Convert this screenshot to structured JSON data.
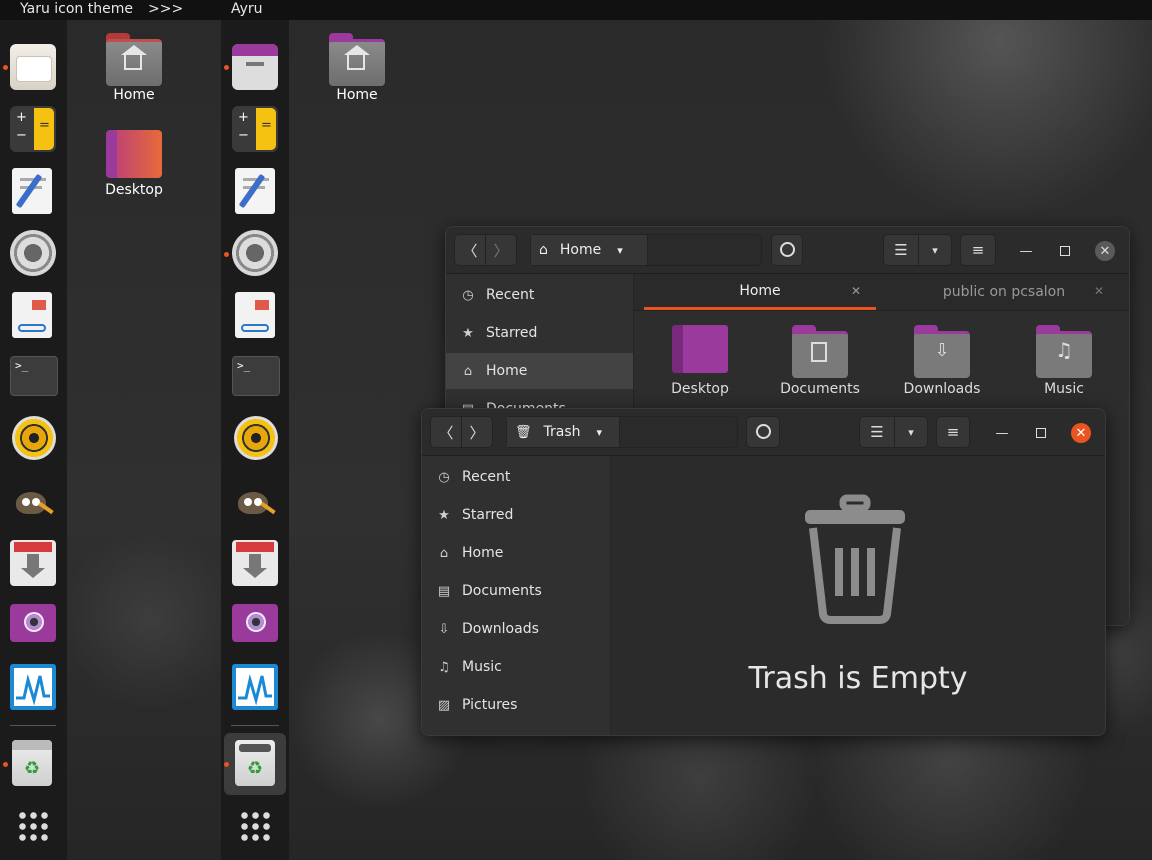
{
  "topbar": {
    "left_label": "Yaru icon theme",
    "arrows": ">>>",
    "right_label": "Ayru"
  },
  "desktop_icons": {
    "left_home": "Home",
    "left_desktop": "Desktop",
    "right_home": "Home"
  },
  "back_window": {
    "location": "Home",
    "sidebar": [
      "Recent",
      "Starred",
      "Home",
      "Documents"
    ],
    "tabs": [
      {
        "label": "Home",
        "active": true
      },
      {
        "label": "public on pcsalon",
        "active": false
      }
    ],
    "folders": [
      "Desktop",
      "Documents",
      "Downloads",
      "Music"
    ]
  },
  "trash_window": {
    "location": "Trash",
    "sidebar": [
      "Recent",
      "Starred",
      "Home",
      "Documents",
      "Downloads",
      "Music",
      "Pictures"
    ],
    "empty_message": "Trash is Empty"
  },
  "colors": {
    "accent_orange": "#e95420",
    "folder_purple": "#9a3a9c",
    "dock_bg": "#1b1b1b",
    "window_bg": "#2d2d2d"
  },
  "icons": {
    "dock_apps": [
      "files-icon",
      "calculator-icon",
      "text-editor-icon",
      "settings-icon",
      "document-viewer-icon",
      "terminal-icon",
      "rhythmbox-icon",
      "gimp-icon",
      "software-installer-icon",
      "camera-app-icon",
      "system-monitor-icon",
      "trash-icon",
      "show-apps-grid-icon"
    ]
  }
}
